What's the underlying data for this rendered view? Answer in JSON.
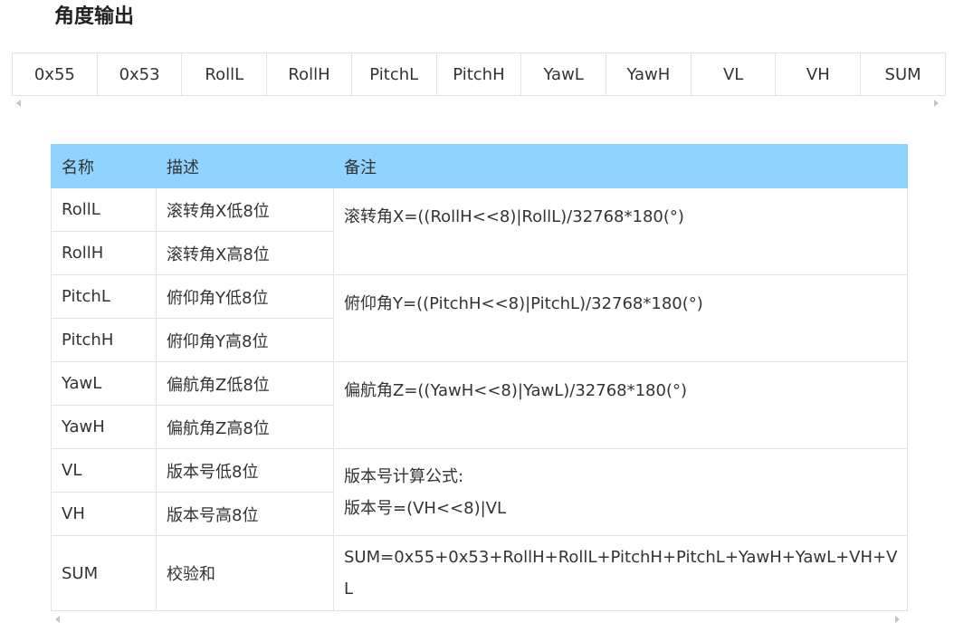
{
  "heading": "角度输出",
  "packet_fields": [
    "0x55",
    "0x53",
    "RollL",
    "RollH",
    "PitchL",
    "PitchH",
    "YawL",
    "YawH",
    "VL",
    "VH",
    "SUM"
  ],
  "table": {
    "headers": {
      "name": "名称",
      "desc": "描述",
      "note": "备注"
    },
    "rows": [
      {
        "name": "RollL",
        "desc": "滚转角X低8位"
      },
      {
        "name": "RollH",
        "desc": "滚转角X高8位"
      },
      {
        "name": "PitchL",
        "desc": "俯仰角Y低8位"
      },
      {
        "name": "PitchH",
        "desc": "俯仰角Y高8位"
      },
      {
        "name": "YawL",
        "desc": "偏航角Z低8位"
      },
      {
        "name": "YawH",
        "desc": "偏航角Z高8位"
      },
      {
        "name": "VL",
        "desc": "版本号低8位"
      },
      {
        "name": "VH",
        "desc": "版本号高8位"
      },
      {
        "name": "SUM",
        "desc": "校验和"
      }
    ],
    "notes": {
      "roll": "滚转角X=((RollH<<8)|RollL)/32768*180(°)",
      "pitch": "俯仰角Y=((PitchH<<8)|PitchL)/32768*180(°)",
      "yaw": "偏航角Z=((YawH<<8)|YawL)/32768*180(°)",
      "version_line1": "版本号计算公式:",
      "version_line2": "版本号=(VH<<8)|VL",
      "sum_line1": "SUM=0x55+0x53+RollH+RollL+PitchH+PitchL+YawH+YawL+VH+V",
      "sum_line2": "L"
    }
  },
  "colors": {
    "header_bg": "#8fd3fe",
    "border": "#e3e3e3",
    "text": "#333333"
  }
}
